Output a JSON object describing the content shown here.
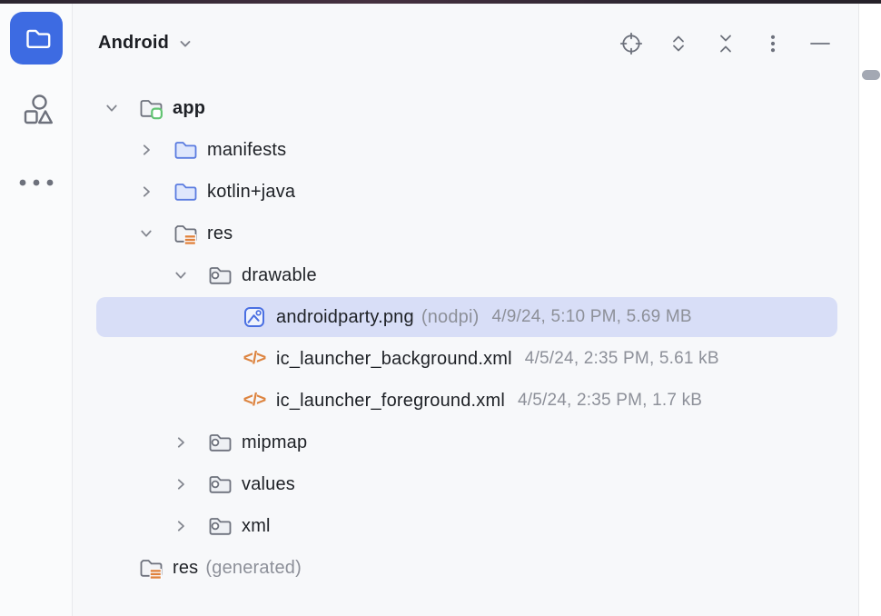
{
  "header": {
    "title": "Android",
    "actions": [
      {
        "name": "locate-file-button",
        "icon": "locate-icon"
      },
      {
        "name": "expand-all-button",
        "icon": "expand-all-icon"
      },
      {
        "name": "collapse-all-button",
        "icon": "collapse-all-icon"
      },
      {
        "name": "more-options-button",
        "icon": "kebab-icon"
      },
      {
        "name": "hide-panel-button",
        "icon": "minimize-icon"
      }
    ]
  },
  "stripe": {
    "items": [
      {
        "name": "project-tool-button",
        "icon": "project-folder-icon",
        "active": true
      },
      {
        "name": "structure-tool-button",
        "icon": "structure-icon",
        "active": false
      },
      {
        "name": "more-tool-windows-button",
        "icon": "more-dots-icon",
        "active": false
      }
    ]
  },
  "tree": {
    "rows": [
      {
        "label": "app",
        "bold": true,
        "icon": "module-folder-icon",
        "chevron": "expanded",
        "indent": 30,
        "selected": false
      },
      {
        "label": "manifests",
        "icon": "blue-folder-icon",
        "chevron": "collapsed",
        "indent": 68
      },
      {
        "label": "kotlin+java",
        "icon": "blue-folder-icon",
        "chevron": "collapsed",
        "indent": 68
      },
      {
        "label": "res",
        "icon": "res-folder-icon",
        "chevron": "expanded",
        "indent": 68
      },
      {
        "label": "drawable",
        "icon": "asset-folder-icon",
        "chevron": "expanded",
        "indent": 106
      },
      {
        "label": "androidparty.png",
        "qualifier": "(nodpi)",
        "meta": "4/9/24, 5:10 PM, 5.69 MB",
        "icon": "image-icon",
        "chevron": "none",
        "indent": 184,
        "selected": true
      },
      {
        "label": "ic_launcher_background.xml",
        "meta": "4/5/24, 2:35 PM, 5.61 kB",
        "icon": "xml-icon",
        "chevron": "none",
        "indent": 184
      },
      {
        "label": "ic_launcher_foreground.xml",
        "meta": "4/5/24, 2:35 PM, 1.7 kB",
        "icon": "xml-icon",
        "chevron": "none",
        "indent": 184
      },
      {
        "label": "mipmap",
        "icon": "asset-folder-icon",
        "chevron": "collapsed",
        "indent": 106
      },
      {
        "label": "values",
        "icon": "asset-folder-icon",
        "chevron": "collapsed",
        "indent": 106
      },
      {
        "label": "xml",
        "icon": "asset-folder-icon",
        "chevron": "collapsed",
        "indent": 106
      },
      {
        "label": "res",
        "qualifier": "(generated)",
        "icon": "res-folder-icon",
        "chevron": "none",
        "indent": 70
      }
    ]
  },
  "colors": {
    "accent": "#3d6be2",
    "selection": "#d8def7",
    "topbar": "#342b3a",
    "panel_bg": "#f7f8fa",
    "icon_gray": "#6d717c",
    "text": "#1e2126",
    "muted": "#8d9099",
    "orange": "#e0813c",
    "green": "#62c472",
    "folder_blue": "#5b7ce0"
  }
}
